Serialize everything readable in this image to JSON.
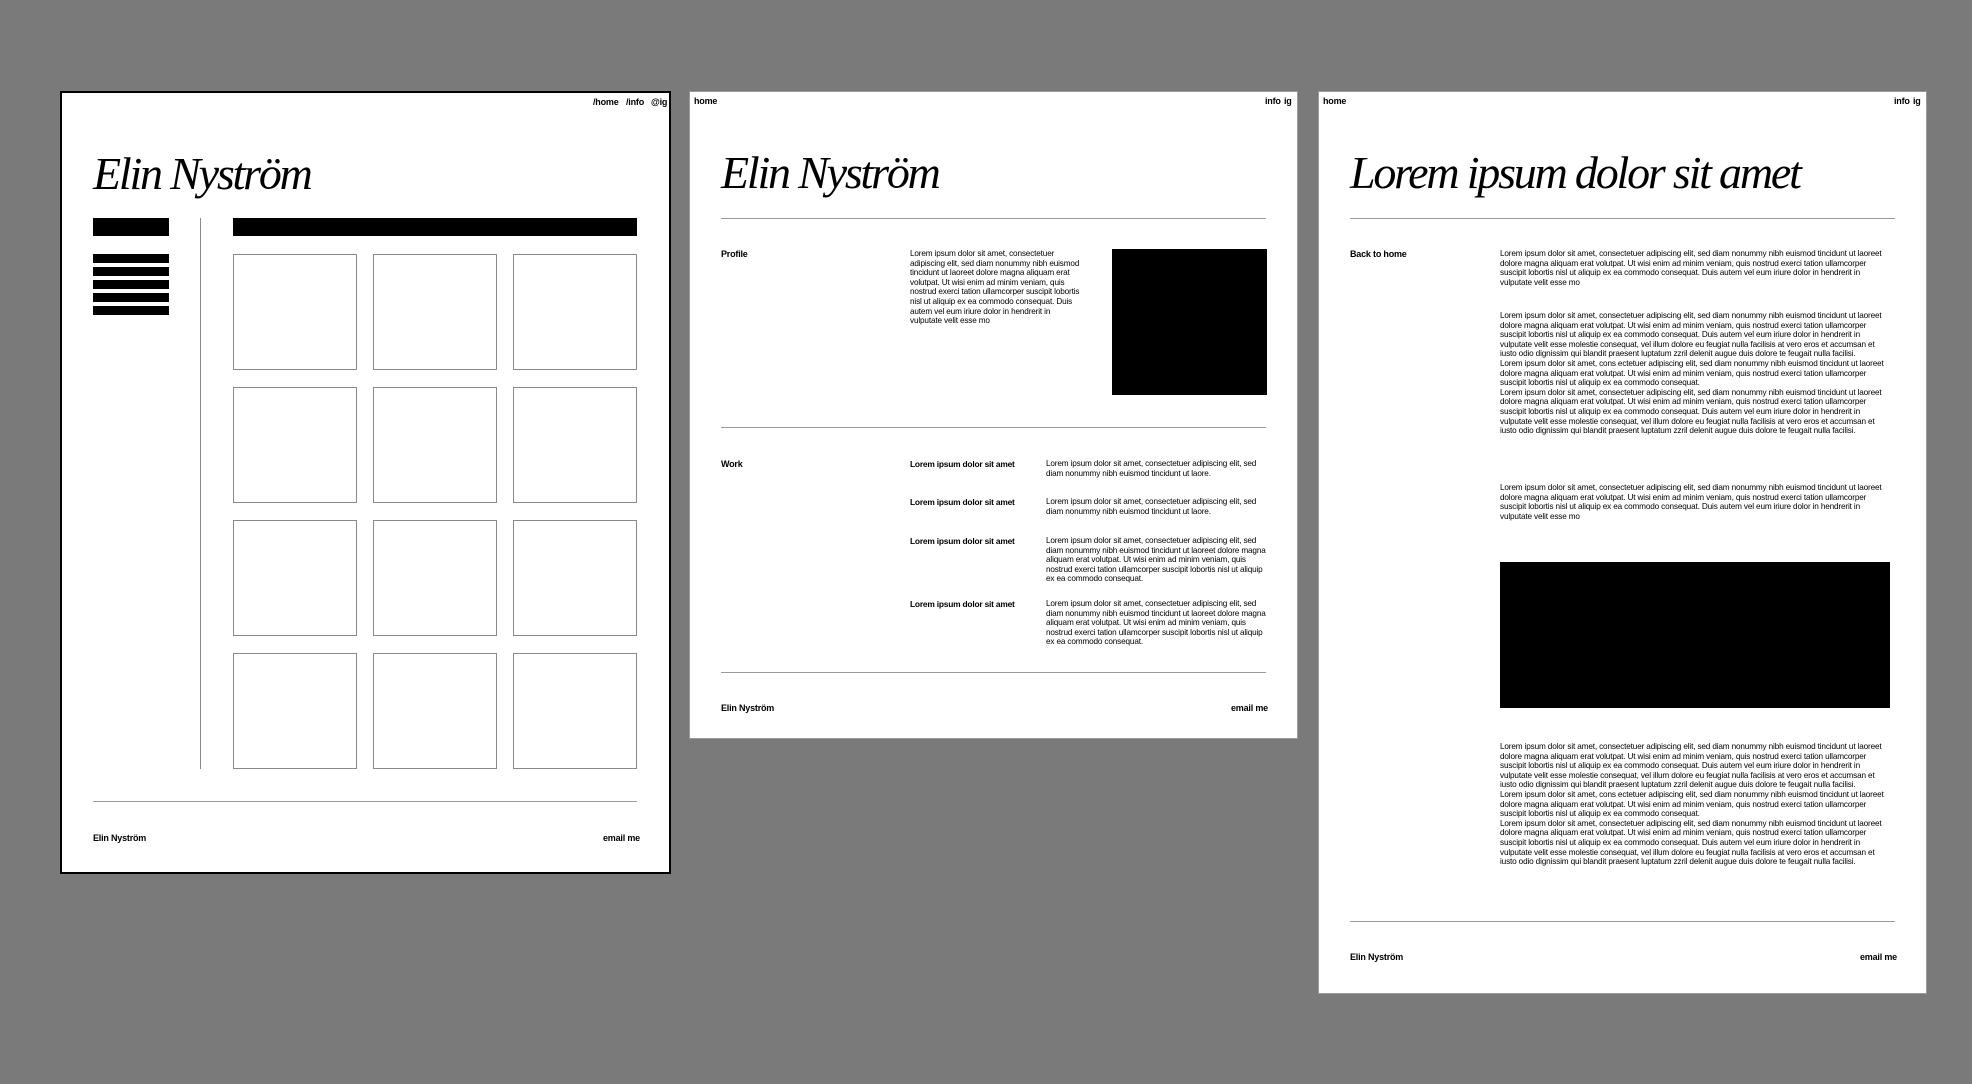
{
  "artboard1": {
    "nav": [
      "/home",
      "/info",
      "@ig"
    ],
    "title": "Elin Nyström",
    "footer_left": "Elin Nyström",
    "footer_right": "email me"
  },
  "artboard2": {
    "nav_left": "home",
    "nav_right": [
      "info",
      "ig"
    ],
    "title": "Elin Nyström",
    "profile_label": "Profile",
    "profile_text": "Lorem ipsum dolor sit amet, consectetuer adipiscing elit, sed diam nonummy nibh euismod tincidunt ut laoreet dolore magna aliquam erat volutpat. Ut wisi enim ad minim veniam, quis nostrud exerci tation ullamcorper suscipit lobortis nisl ut aliquip ex ea commodo consequat. Duis autem vel eum iriure dolor in hendrerit in vulputate velit esse mo",
    "work_label": "Work",
    "work_items": [
      {
        "title": "Lorem ipsum dolor sit amet",
        "text": "Lorem ipsum dolor sit amet, consectetuer adipiscing elit, sed diam nonummy nibh euismod tincidunt ut laore."
      },
      {
        "title": "Lorem ipsum dolor sit amet",
        "text": "Lorem ipsum dolor sit amet, consectetuer adipiscing elit, sed diam nonummy nibh euismod tincidunt ut laore."
      },
      {
        "title": "Lorem ipsum dolor sit amet",
        "text": "Lorem ipsum dolor sit amet, consectetuer adipiscing elit, sed diam nonummy nibh euismod tincidunt ut laoreet dolore magna aliquam erat volutpat. Ut wisi enim ad minim veniam, quis nostrud exerci tation ullamcorper suscipit lobortis nisl ut aliquip ex ea commodo consequat."
      },
      {
        "title": "Lorem ipsum dolor sit amet",
        "text": "Lorem ipsum dolor sit amet, consectetuer adipiscing elit, sed diam nonummy nibh euismod tincidunt ut laoreet dolore magna aliquam erat volutpat. Ut wisi enim ad minim veniam, quis nostrud exerci tation ullamcorper suscipit lobortis nisl ut aliquip ex ea commodo consequat."
      }
    ],
    "footer_left": "Elin Nyström",
    "footer_right": "email me"
  },
  "artboard3": {
    "nav_left": "home",
    "nav_right": [
      "info",
      "ig"
    ],
    "title": "Lorem ipsum dolor sit amet",
    "back_link": "Back to home",
    "paragraphs": [
      [
        "Lorem ipsum dolor sit amet, consectetuer adipiscing elit, sed diam nonummy nibh euismod tincidunt ut laoreet dolore magna aliquam erat volutpat. Ut wisi enim ad minim veniam, quis nostrud exerci tation ullamcorper suscipit lobortis nisl ut aliquip ex ea commodo consequat. Duis autem vel eum iriure dolor in hendrerit in vulputate velit esse mo"
      ],
      [
        "Lorem ipsum dolor sit amet, consectetuer adipiscing elit, sed diam nonummy nibh euismod tincidunt ut laoreet dolore magna aliquam erat volutpat. Ut wisi enim ad minim veniam, quis nostrud exerci tation ullamcorper suscipit lobortis nisl ut aliquip ex ea commodo consequat. Duis autem vel eum iriure dolor in hendrerit in vulputate velit esse molestie consequat, vel illum dolore eu feugiat nulla facilisis at vero eros et accumsan et iusto odio dignissim qui blandit praesent luptatum zzril delenit augue duis dolore te feugait nulla facilisi.",
        "Lorem ipsum dolor sit amet, cons ectetuer adipiscing elit, sed diam nonummy nibh euismod tincidunt ut laoreet dolore magna aliquam erat volutpat. Ut wisi enim ad minim veniam, quis nostrud exerci tation ullamcorper suscipit lobortis nisl ut aliquip ex ea commodo consequat.",
        "Lorem ipsum dolor sit amet, consectetuer adipiscing elit, sed diam nonummy nibh euismod tincidunt ut laoreet dolore magna aliquam erat volutpat. Ut wisi enim ad minim veniam, quis nostrud exerci tation ullamcorper suscipit lobortis nisl ut aliquip ex ea commodo consequat. Duis autem vel eum iriure dolor in hendrerit in vulputate velit esse molestie consequat, vel illum dolore eu feugiat nulla facilisis at vero eros et accumsan et iusto odio dignissim qui blandit praesent luptatum zzril delenit augue duis dolore te feugait nulla facilisi."
      ],
      [
        "Lorem ipsum dolor sit amet, consectetuer adipiscing elit, sed diam nonummy nibh euismod tincidunt ut laoreet dolore magna aliquam erat volutpat. Ut wisi enim ad minim veniam, quis nostrud exerci tation ullamcorper suscipit lobortis nisl ut aliquip ex ea commodo consequat. Duis autem vel eum iriure dolor in hendrerit in vulputate velit esse mo"
      ],
      [
        "Lorem ipsum dolor sit amet, consectetuer adipiscing elit, sed diam nonummy nibh euismod tincidunt ut laoreet dolore magna aliquam erat volutpat. Ut wisi enim ad minim veniam, quis nostrud exerci tation ullamcorper suscipit lobortis nisl ut aliquip ex ea commodo consequat. Duis autem vel eum iriure dolor in hendrerit in vulputate velit esse molestie consequat, vel illum dolore eu feugiat nulla facilisis at vero eros et accumsan et iusto odio dignissim qui blandit praesent luptatum zzril delenit augue duis dolore te feugait nulla facilisi.",
        "Lorem ipsum dolor sit amet, cons ectetuer adipiscing elit, sed diam nonummy nibh euismod tincidunt ut laoreet dolore magna aliquam erat volutpat. Ut wisi enim ad minim veniam, quis nostrud exerci tation ullamcorper suscipit lobortis nisl ut aliquip ex ea commodo consequat.",
        "Lorem ipsum dolor sit amet, consectetuer adipiscing elit, sed diam nonummy nibh euismod tincidunt ut laoreet dolore magna aliquam erat volutpat. Ut wisi enim ad minim veniam, quis nostrud exerci tation ullamcorper suscipit lobortis nisl ut aliquip ex ea commodo consequat. Duis autem vel eum iriure dolor in hendrerit in vulputate velit esse molestie consequat, vel illum dolore eu feugiat nulla facilisis at vero eros et accumsan et iusto odio dignissim qui blandit praesent luptatum zzril delenit augue duis dolore te feugait nulla facilisi."
      ]
    ],
    "footer_left": "Elin Nyström",
    "footer_right": "email me"
  }
}
